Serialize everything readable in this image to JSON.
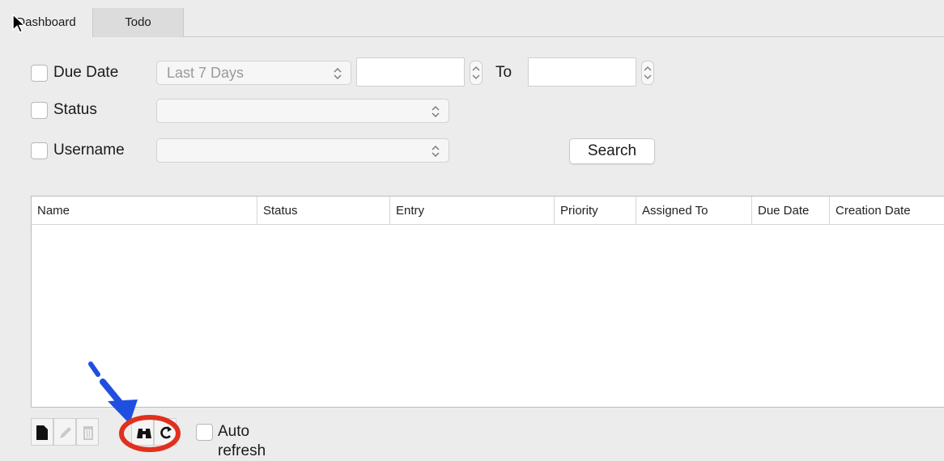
{
  "tabs": [
    {
      "label": "Dashboard",
      "active": true
    },
    {
      "label": "Todo",
      "active": false
    }
  ],
  "filters": {
    "due_date": {
      "label": "Due Date",
      "checked": false,
      "range_value": "Last 7 Days",
      "from_value": "",
      "to_label": "To",
      "to_value": ""
    },
    "status": {
      "label": "Status",
      "checked": false,
      "value": ""
    },
    "username": {
      "label": "Username",
      "checked": false,
      "value": ""
    },
    "search_label": "Search"
  },
  "table": {
    "columns": [
      "Name",
      "Status",
      "Entry",
      "Priority",
      "Assigned To",
      "Due Date",
      "Creation Date"
    ],
    "rows": []
  },
  "toolbar": {
    "buttons": [
      "new-document-icon",
      "edit-pencil-icon",
      "delete-trash-icon",
      "find-binoculars-icon",
      "refresh-icon"
    ],
    "auto_refresh_label": "Auto refresh",
    "auto_refresh_checked": false
  },
  "annotation": {
    "arrow_color": "#1f4fe0",
    "circle_color": "#e0301e"
  }
}
